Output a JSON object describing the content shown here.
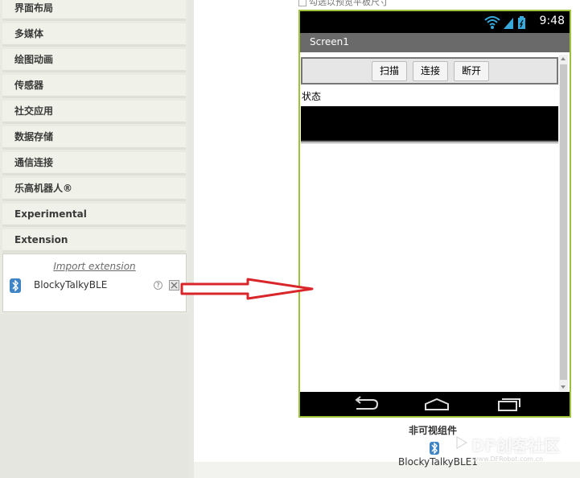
{
  "palette": {
    "categories": [
      {
        "label": "界面布局"
      },
      {
        "label": "多媒体"
      },
      {
        "label": "绘图动画"
      },
      {
        "label": "传感器"
      },
      {
        "label": "社交应用"
      },
      {
        "label": "数据存储"
      },
      {
        "label": "通信连接"
      },
      {
        "label": "乐高机器人®"
      },
      {
        "label": "Experimental"
      },
      {
        "label": "Extension"
      }
    ],
    "import_link": "Import extension",
    "extension_item": {
      "name": "BlockyTalkyBLE",
      "help_icon": "question-icon",
      "delete_icon": "close-box-icon"
    }
  },
  "viewer": {
    "tablet_preview_label": "勾选以预览平板尺寸",
    "phone": {
      "time": "9:48",
      "status_icons": [
        "wifi-icon",
        "signal-icon",
        "battery-icon"
      ],
      "screen_title": "Screen1",
      "buttons": [
        {
          "label": "扫描"
        },
        {
          "label": "连接"
        },
        {
          "label": "断开"
        }
      ],
      "status_label": "状态",
      "nav_icons": [
        "back-icon",
        "home-icon",
        "recents-icon"
      ]
    },
    "nonvisible_title": "非可视组件",
    "nonvisible_component": "BlockyTalkyBLE1"
  },
  "watermark": {
    "text": "DF创客社区",
    "url": "www.DFRobot.com.cn"
  },
  "colors": {
    "phone_border": "#9ec33b",
    "arrow_red": "#d9262a",
    "bluetooth_blue": "#3f84c4"
  }
}
